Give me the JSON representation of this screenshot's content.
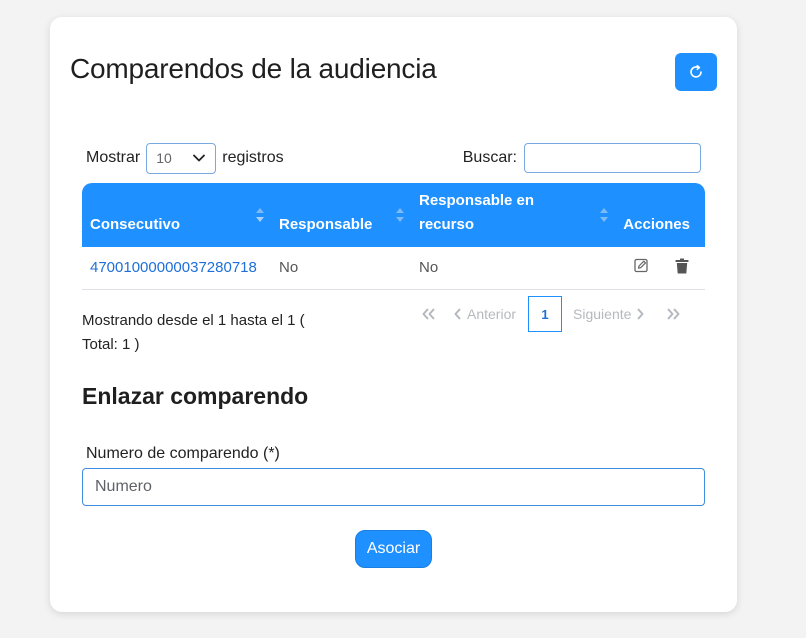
{
  "card": {
    "title": "Comparendos de la audiencia",
    "refresh_icon": "refresh-icon"
  },
  "table_controls": {
    "show_label": "Mostrar",
    "page_size": "10",
    "records_label": "registros",
    "search_label": "Buscar:",
    "search_value": ""
  },
  "table": {
    "columns": [
      "Consecutivo",
      "Responsable",
      "Responsable en recurso",
      "Acciones"
    ],
    "rows": [
      {
        "consecutivo": "47001000000037280718",
        "responsable": "No",
        "responsable_recurso": "No",
        "actions": [
          "edit-icon",
          "trash-icon"
        ]
      }
    ]
  },
  "pagination": {
    "info_line1": "Mostrando desde el 1 hasta el 1 (",
    "info_line2": "Total: 1 )",
    "previous": "Anterior",
    "next": "Siguiente",
    "current_page": "1"
  },
  "link_section": {
    "title": "Enlazar comparendo",
    "field_label": "Numero de comparendo (*)",
    "field_placeholder": "Numero",
    "field_value": "",
    "submit_label": "Asociar"
  },
  "colors": {
    "accent": "#1e90ff",
    "link": "#1e6fd9",
    "background": "#f3f3f4"
  }
}
